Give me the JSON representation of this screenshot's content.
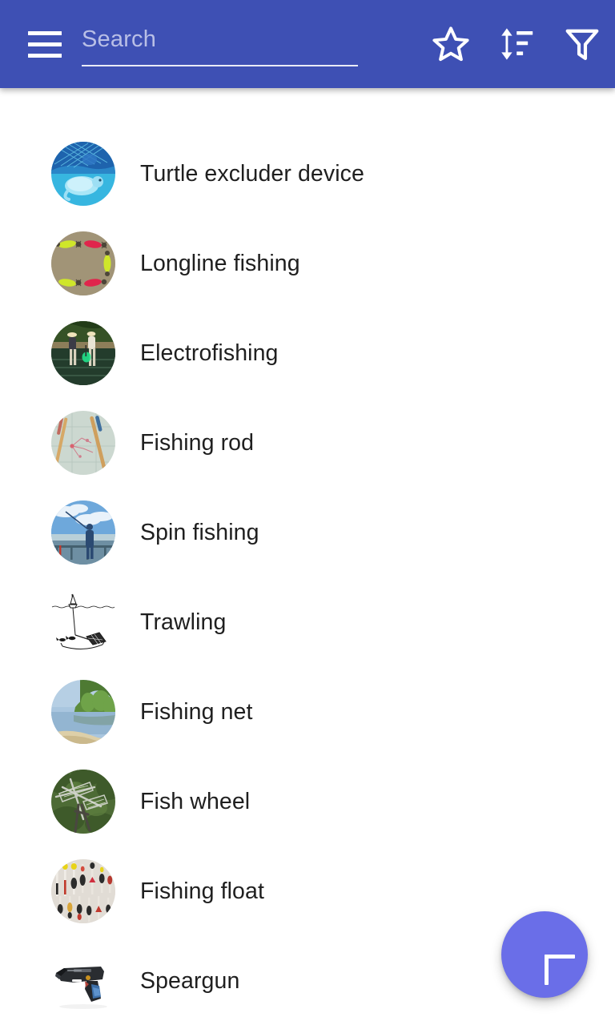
{
  "app": {
    "toolbar_color": "#3e50b4",
    "fab_color": "#6a6ee8",
    "text_color": "#1f1f1f"
  },
  "toolbar": {
    "menu_label": "Menu",
    "search": {
      "placeholder": "Search",
      "value": ""
    },
    "actions": [
      {
        "name": "favorites-button",
        "icon": "star-icon",
        "label": "Favorites"
      },
      {
        "name": "sort-button",
        "icon": "sort-icon",
        "label": "Sort"
      },
      {
        "name": "filter-button",
        "icon": "filter-icon",
        "label": "Filter"
      }
    ]
  },
  "list": {
    "items": [
      {
        "label": "Turtle excluder device",
        "thumb": "turtle-excluder-device-thumbnail",
        "style": "circle"
      },
      {
        "label": "Longline fishing",
        "thumb": "longline-fishing-thumbnail",
        "style": "circle"
      },
      {
        "label": "Electrofishing",
        "thumb": "electrofishing-thumbnail",
        "style": "circle"
      },
      {
        "label": "Fishing rod",
        "thumb": "fishing-rod-thumbnail",
        "style": "circle"
      },
      {
        "label": "Spin fishing",
        "thumb": "spin-fishing-thumbnail",
        "style": "circle"
      },
      {
        "label": "Trawling",
        "thumb": "trawling-thumbnail",
        "style": "plain"
      },
      {
        "label": "Fishing net",
        "thumb": "fishing-net-thumbnail",
        "style": "circle"
      },
      {
        "label": "Fish wheel",
        "thumb": "fish-wheel-thumbnail",
        "style": "circle"
      },
      {
        "label": "Fishing float",
        "thumb": "fishing-float-thumbnail",
        "style": "circle"
      },
      {
        "label": "Speargun",
        "thumb": "speargun-thumbnail",
        "style": "plain"
      }
    ]
  },
  "fab": {
    "icon": "plus-icon",
    "label": "Add"
  }
}
